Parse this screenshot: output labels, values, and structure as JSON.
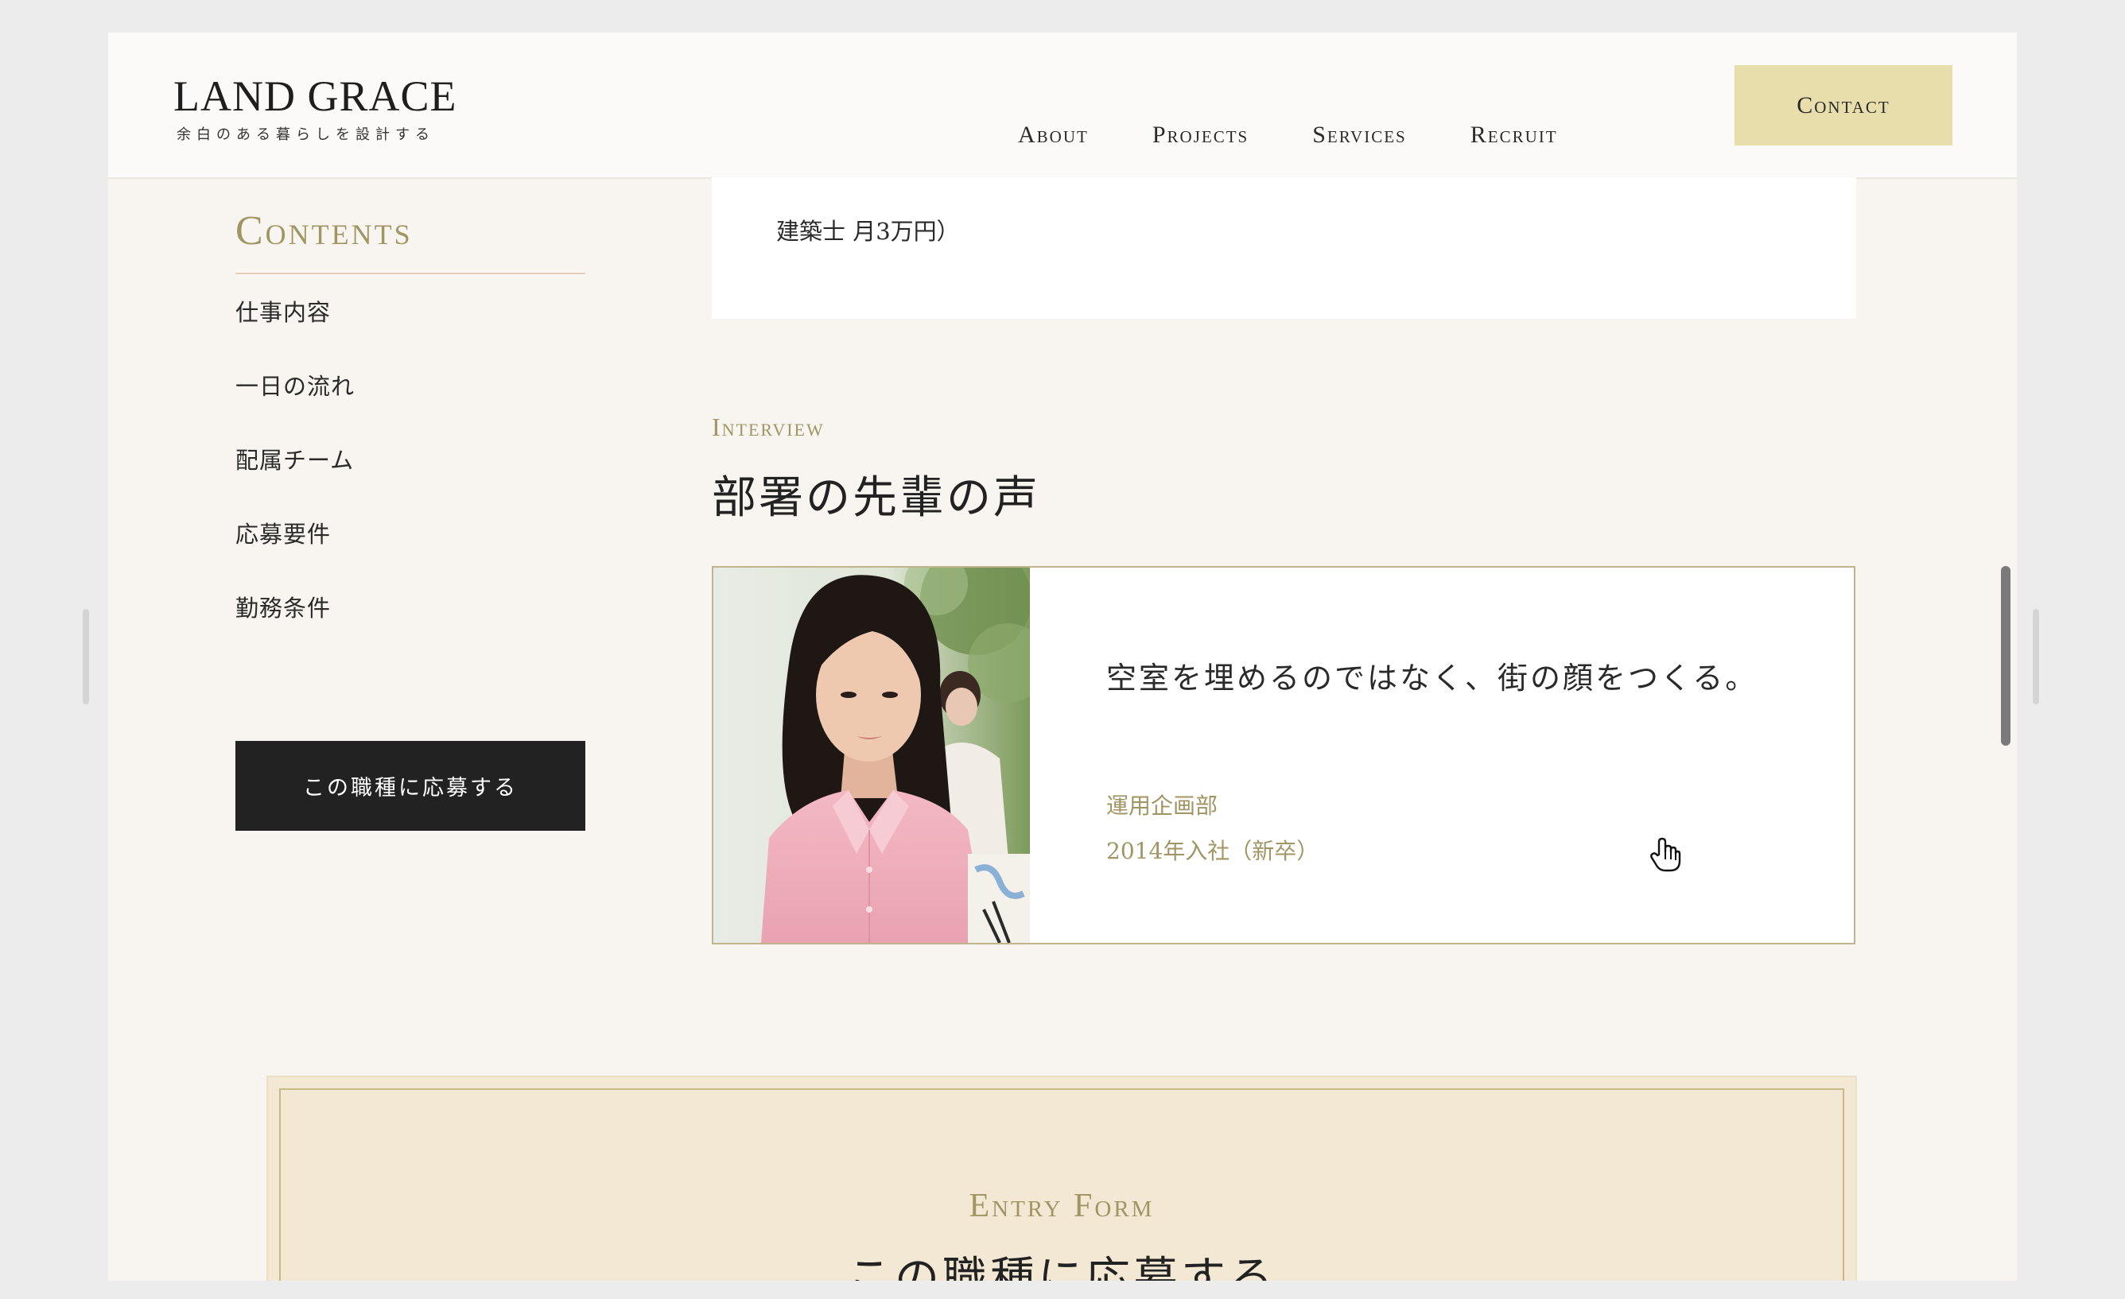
{
  "header": {
    "brand_name": "LAND GRACE",
    "brand_tagline": "余白のある暮らしを設計する",
    "nav": [
      "About",
      "Projects",
      "Services",
      "Recruit"
    ],
    "contact_label": "Contact"
  },
  "sidebar": {
    "title": "Contents",
    "items": [
      "仕事内容",
      "一日の流れ",
      "配属チーム",
      "応募要件",
      "勤務条件"
    ],
    "apply_label": "この職種に応募する"
  },
  "previous_card": {
    "text": "建築士 月3万円）"
  },
  "interview": {
    "eyebrow": "Interview",
    "heading": "部署の先輩の声",
    "quote": "空室を埋めるのではなく、街の顔をつくる。",
    "department": "運用企画部",
    "joined": "2014年入社（新卒）"
  },
  "entry_form": {
    "eyebrow": "Entry Form",
    "heading": "この職種に応募する"
  },
  "colors": {
    "accent_gold": "#a09563",
    "contact_bg": "#e8deac",
    "page_bg": "#f8f5f0",
    "entry_bg": "#f2e8d4",
    "dark_button": "#222222"
  },
  "icons": {
    "cursor": "hand-pointer-icon"
  }
}
